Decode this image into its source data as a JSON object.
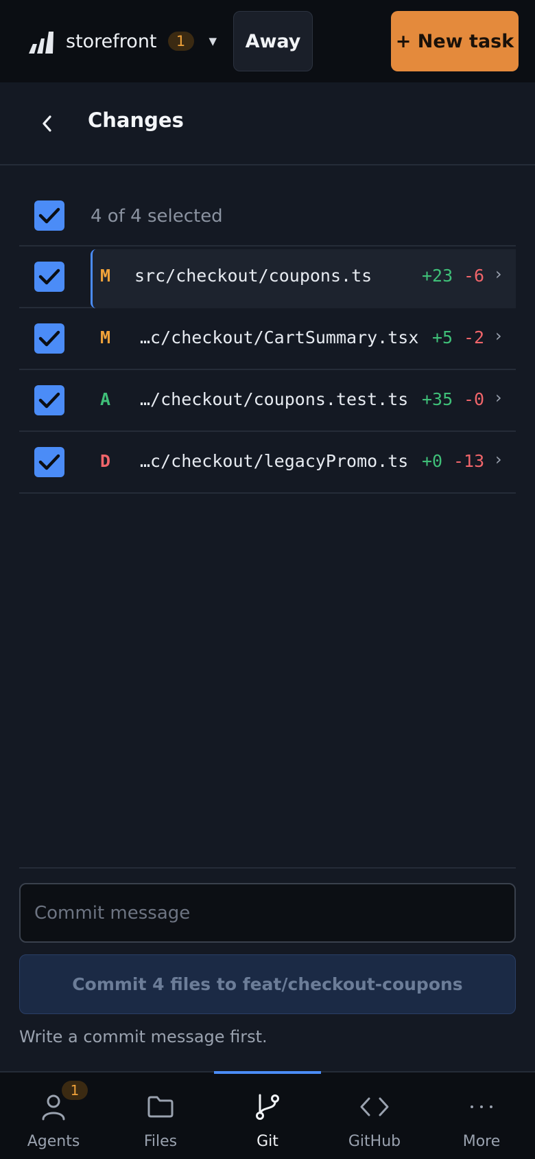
{
  "topbar": {
    "project_name": "storefront",
    "project_badge": "1",
    "away_label": "Away",
    "new_task_label": "+ New task"
  },
  "header": {
    "title": "Changes"
  },
  "selection": {
    "label": "4 of 4 selected"
  },
  "files": [
    {
      "status": "M",
      "path": "src/checkout/coupons.ts",
      "additions": "+23",
      "deletions": "-6"
    },
    {
      "status": "M",
      "path": "…c/checkout/CartSummary.tsx",
      "additions": "+5",
      "deletions": "-2"
    },
    {
      "status": "A",
      "path": "…/checkout/coupons.test.ts",
      "additions": "+35",
      "deletions": "-0"
    },
    {
      "status": "D",
      "path": "…c/checkout/legacyPromo.ts",
      "additions": "+0",
      "deletions": "-13"
    }
  ],
  "commit": {
    "placeholder": "Commit message",
    "button_label": "Commit 4 files to feat/checkout-coupons",
    "hint": "Write a commit message first."
  },
  "nav": {
    "agents": {
      "label": "Agents",
      "badge": "1"
    },
    "files": {
      "label": "Files"
    },
    "git": {
      "label": "Git"
    },
    "github": {
      "label": "GitHub"
    },
    "more": {
      "label": "More"
    }
  },
  "colors": {
    "accent": "#4b8cf7",
    "primary_button": "#e48a3c",
    "modified": "#f0a23a",
    "added": "#3fbf78",
    "deleted": "#f0656a"
  }
}
